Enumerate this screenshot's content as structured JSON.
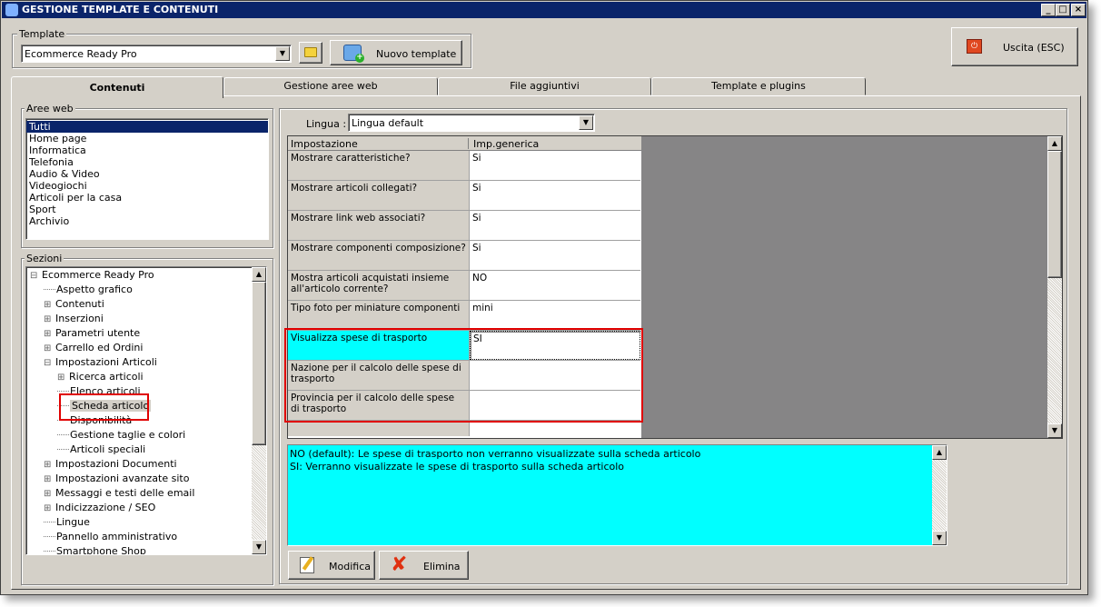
{
  "window": {
    "title": "GESTIONE TEMPLATE E CONTENUTI"
  },
  "template_group": {
    "label": "Template",
    "selected": "Ecommerce Ready Pro",
    "new_button": "Nuovo template"
  },
  "exit_button": "Uscita (ESC)",
  "tabs": [
    {
      "label": "Contenuti",
      "active": true
    },
    {
      "label": "Gestione aree web",
      "active": false
    },
    {
      "label": "File aggiuntivi",
      "active": false
    },
    {
      "label": "Template e plugins",
      "active": false
    }
  ],
  "aree_web": {
    "label": "Aree web",
    "items": [
      "Tutti",
      "Home page",
      "Informatica",
      "Telefonia",
      "Audio & Video",
      "Videogiochi",
      "Articoli per la casa",
      "Sport",
      "Archivio"
    ],
    "selected": "Tutti"
  },
  "sezioni": {
    "label": "Sezioni",
    "items": [
      {
        "label": "Ecommerce Ready Pro",
        "expander": "⊟"
      },
      {
        "label": "Aspetto grafico",
        "expander": ""
      },
      {
        "label": "Contenuti",
        "expander": "⊞"
      },
      {
        "label": "Inserzioni",
        "expander": "⊞"
      },
      {
        "label": "Parametri utente",
        "expander": "⊞"
      },
      {
        "label": "Carrello ed Ordini",
        "expander": "⊞"
      },
      {
        "label": "Impostazioni Articoli",
        "expander": "⊟"
      },
      {
        "label": "Ricerca articoli",
        "expander": "⊞"
      },
      {
        "label": "Elenco articoli",
        "expander": ""
      },
      {
        "label": "Scheda articolo",
        "expander": ""
      },
      {
        "label": "Disponibilità",
        "expander": ""
      },
      {
        "label": "Gestione taglie e colori",
        "expander": ""
      },
      {
        "label": "Articoli speciali",
        "expander": ""
      },
      {
        "label": "Impostazioni Documenti",
        "expander": "⊞"
      },
      {
        "label": "Impostazioni avanzate sito",
        "expander": "⊞"
      },
      {
        "label": "Messaggi e testi delle email",
        "expander": "⊞"
      },
      {
        "label": "Indicizzazione / SEO",
        "expander": "⊞"
      },
      {
        "label": "Lingue",
        "expander": ""
      },
      {
        "label": "Pannello amministrativo",
        "expander": ""
      },
      {
        "label": "Smartphone Shop",
        "expander": ""
      }
    ],
    "selected": "Scheda articolo"
  },
  "lingua": {
    "label": "Lingua :",
    "selected": "Lingua default"
  },
  "grid": {
    "headers": [
      "Impostazione",
      "Imp.generica"
    ],
    "rows": [
      {
        "key": "Mostrare caratteristiche?",
        "value": "Si"
      },
      {
        "key": "Mostrare articoli collegati?",
        "value": "Si"
      },
      {
        "key": "Mostrare link web associati?",
        "value": "Si"
      },
      {
        "key": "Mostrare componenti composizione?",
        "value": "Si"
      },
      {
        "key": "Mostra articoli acquistati insieme all'articolo corrente?",
        "value": "NO"
      },
      {
        "key": "Tipo foto per miniature componenti",
        "value": "mini"
      },
      {
        "key": "Visualizza spese di trasporto",
        "value": "SI"
      },
      {
        "key": "Nazione per il calcolo delle spese di trasporto",
        "value": ""
      },
      {
        "key": "Provincia per il calcolo delle spese di trasporto",
        "value": ""
      }
    ]
  },
  "description": {
    "lines": [
      "NO (default): Le spese di trasporto non verranno visualizzate sulla scheda articolo",
      "SI: Verranno visualizzate le spese di trasporto sulla scheda articolo"
    ]
  },
  "buttons": {
    "modifica": "Modifica",
    "elimina": "Elimina"
  },
  "colors": {
    "title_bar": "#0a246a",
    "selection": "#0a246a",
    "highlight_cell": "#00ffff",
    "annotation": "#e00000"
  }
}
